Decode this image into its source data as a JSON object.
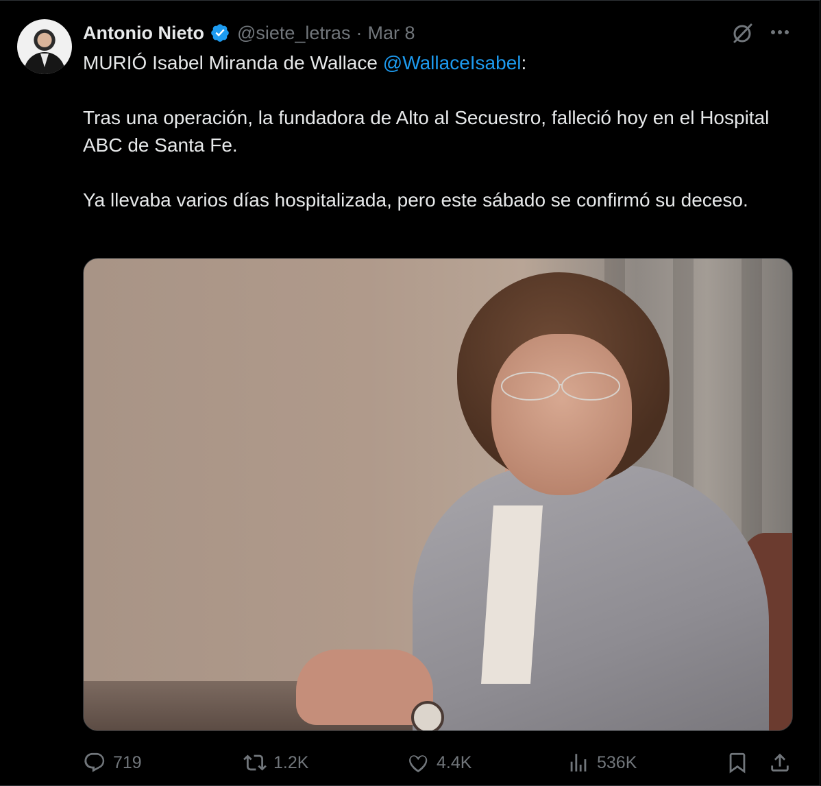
{
  "author": {
    "name": "Antonio Nieto",
    "handle": "@siete_letras",
    "separator": "·",
    "date": "Mar 8",
    "verified": true
  },
  "tweet": {
    "line1_prefix": "MURIÓ Isabel Miranda de Wallace ",
    "mention": "@WallaceIsabel",
    "line1_suffix": ":",
    "paragraph2": "Tras una operación, la fundadora de Alto al Secuestro, falleció hoy en el Hospital ABC de Santa Fe.",
    "paragraph3": "Ya llevaba varios días hospitalizada, pero este sábado se confirmó su deceso."
  },
  "actions": {
    "replies": "719",
    "reposts": "1.2K",
    "likes": "4.4K",
    "views": "536K"
  },
  "colors": {
    "background": "#000000",
    "text": "#e7e9ea",
    "muted": "#71767b",
    "accent": "#1d9bf0"
  },
  "icons": [
    "grok-icon",
    "more-icon",
    "verified-badge-icon",
    "reply-icon",
    "repost-icon",
    "like-icon",
    "views-icon",
    "bookmark-icon",
    "share-icon"
  ]
}
